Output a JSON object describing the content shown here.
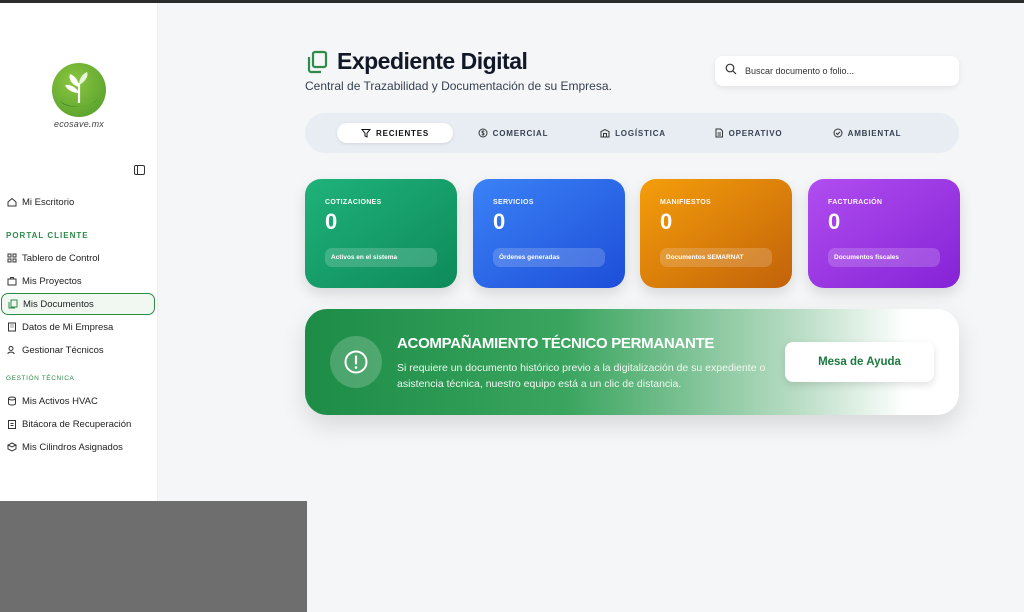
{
  "brand": {
    "logo_text": "ecosave.mx"
  },
  "sidebar": {
    "top_item": {
      "label": "Mi Escritorio",
      "icon": "home-icon"
    },
    "section_portal": "PORTAL CLIENTE",
    "portal_items": [
      {
        "label": "Tablero de Control",
        "icon": "grid-icon"
      },
      {
        "label": "Mis Proyectos",
        "icon": "briefcase-icon"
      },
      {
        "label": "Mis Documentos",
        "icon": "documents-icon",
        "active": true
      },
      {
        "label": "Datos de Mi Empresa",
        "icon": "building-icon"
      },
      {
        "label": "Gestionar Técnicos",
        "icon": "users-icon"
      }
    ],
    "section_tecnica": "GESTIÓN TÉCNICA",
    "tecnica_items": [
      {
        "label": "Mis Activos HVAC",
        "icon": "database-icon"
      },
      {
        "label": "Bitácora de Recuperación",
        "icon": "clipboard-icon"
      },
      {
        "label": "Mis Cilindros Asignados",
        "icon": "cylinder-icon"
      }
    ]
  },
  "header": {
    "title": "Expediente Digital",
    "subtitle": "Central de Trazabilidad y Documentación de su Empresa."
  },
  "search": {
    "placeholder": "Buscar documento o folio..."
  },
  "tabs": [
    {
      "label": "RECIENTES",
      "icon": "filter-icon",
      "active": true
    },
    {
      "label": "COMERCIAL",
      "icon": "dollar-icon"
    },
    {
      "label": "LOGÍSTICA",
      "icon": "warehouse-icon"
    },
    {
      "label": "OPERATIVO",
      "icon": "file-icon"
    },
    {
      "label": "AMBIENTAL",
      "icon": "check-circle-icon"
    }
  ],
  "cards": [
    {
      "label": "COTIZACIONES",
      "value": "0",
      "pill": "Activos en el sistema",
      "color": "#159f6a"
    },
    {
      "label": "SERVICIOS",
      "value": "0",
      "pill": "Órdenes generadas",
      "color": "#2563eb"
    },
    {
      "label": "MANIFIESTOS",
      "value": "0",
      "pill": "Documentos SEMARNAT",
      "color": "#e8830b"
    },
    {
      "label": "FACTURACIÓN",
      "value": "0",
      "pill": "Documentos fiscales",
      "color": "#9b3ae6"
    }
  ],
  "banner": {
    "title": "ACOMPAÑAMIENTO TÉCNICO PERMANANTE",
    "text": "Si requiere un documento histórico previo a la digitalización de su expediente o asistencia técnica, nuestro equipo está a un clic de distancia.",
    "button": "Mesa de Ayuda"
  }
}
